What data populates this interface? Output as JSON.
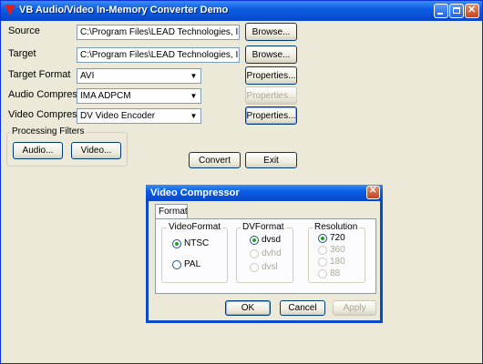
{
  "window": {
    "title": "VB Audio/Video In-Memory Converter Demo"
  },
  "form": {
    "source_label": "Source",
    "source_value": "C:\\Program Files\\LEAD Technologies, Inc\\LEADTOOLS",
    "target_label": "Target",
    "target_value": "C:\\Program Files\\LEAD Technologies, Inc\\LEADTOOLS",
    "target_format_label": "Target Format",
    "target_format_value": "AVI",
    "audio_compressor_label": "Audio Compressor",
    "audio_compressor_value": "IMA ADPCM",
    "video_compressor_label": "Video Compressor",
    "video_compressor_value": "DV Video Encoder",
    "browse_label": "Browse...",
    "properties_label": "Properties..."
  },
  "filters": {
    "title": "Processing Filters",
    "audio_label": "Audio...",
    "video_label": "Video..."
  },
  "actions": {
    "convert_label": "Convert",
    "exit_label": "Exit"
  },
  "dialog": {
    "title": "Video Compressor",
    "tab_label": "Format",
    "videoformat": {
      "title": "VideoFormat",
      "options": [
        "NTSC",
        "PAL"
      ],
      "selected": "NTSC"
    },
    "dvformat": {
      "title": "DVFormat",
      "options": [
        "dvsd",
        "dvhd",
        "dvsl"
      ],
      "selected": "dvsd"
    },
    "resolution": {
      "title": "Resolution",
      "options": [
        "720",
        "360",
        "180",
        "88"
      ],
      "selected": "720"
    },
    "ok_label": "OK",
    "cancel_label": "Cancel",
    "apply_label": "Apply"
  }
}
